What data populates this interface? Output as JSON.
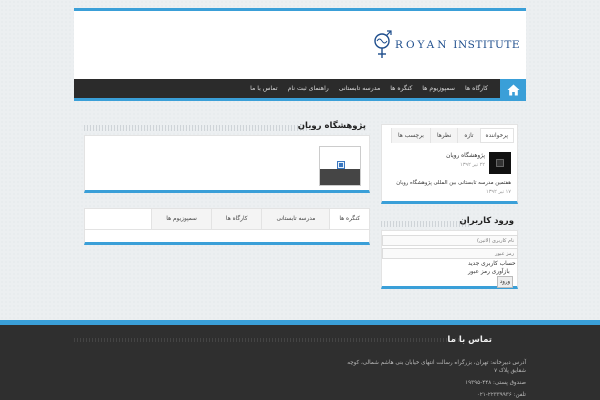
{
  "header": {
    "logo_text_spaced": "ROYAN",
    "logo_text_rest": " INSTITUTE"
  },
  "nav": {
    "items": [
      {
        "label": "کارگاه ها"
      },
      {
        "label": "سمپوزیوم ها"
      },
      {
        "label": "کنگره ها"
      },
      {
        "label": "مدرسه تابستانی"
      },
      {
        "label": "راهنمای ثبت نام"
      },
      {
        "label": "تماس با ما"
      }
    ]
  },
  "main_box": {
    "title": "پژوهشگاه رویان"
  },
  "event_tabs": {
    "items": [
      {
        "label": "کنگره ها"
      },
      {
        "label": "مدرسه تابستانی"
      },
      {
        "label": "کارگاه ها"
      },
      {
        "label": "سمپوزیوم ها"
      }
    ]
  },
  "sidebar_tabs": {
    "items": [
      {
        "label": "پرخواننده"
      },
      {
        "label": "تازه"
      },
      {
        "label": "نظرها"
      },
      {
        "label": "برچسب ها"
      }
    ],
    "posts": [
      {
        "title": "پژوهشگاه رویان",
        "date": "۲۲ تیر ۱۳۹۲"
      },
      {
        "title": "هفتمین مدرسه تابستانی بین المللی پژوهشگاه رویان",
        "date": "۱۷ تیر ۱۳۹۲"
      }
    ]
  },
  "login": {
    "title": "ورود کاربران",
    "username_placeholder": "نام کاربری (لاتین)",
    "password_placeholder": "رمز عبور",
    "register_link": "حساب کاربری جدید",
    "recover_link": "بازآوری رمز عبور",
    "submit_label": "ورود"
  },
  "footer": {
    "title": "تماس با ما",
    "address": "آدرس دبیرخانه: تهران، بزرگراه رسالت انتهای خیابان بنی هاشم شمالی، کوچه شقایق پلاک ۷",
    "po_box": "صندوق پستی: ۴۴۸-۱۹۳۹۵",
    "phone": "تلفن: ۲۲۳۳۹۹۳۶-۰۲۱"
  },
  "colors": {
    "accent": "#3a9fd8",
    "nav_bg": "#2b2b2b",
    "footer_bg": "#2f2f2f",
    "logo": "#1d4d8c"
  }
}
